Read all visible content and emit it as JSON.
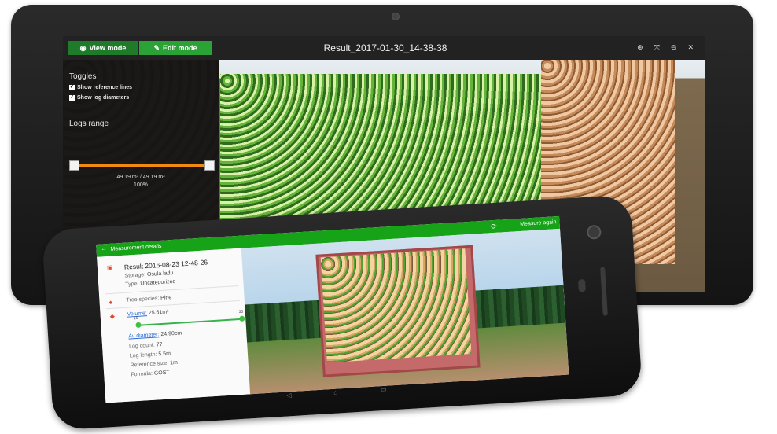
{
  "tablet": {
    "tabs": {
      "view": "View mode",
      "edit": "Edit mode"
    },
    "title": "Result_2017-01-30_14-38-38",
    "toolbar_icons": [
      "zoom-in-icon",
      "fit-icon",
      "zoom-out-icon",
      "close-icon"
    ],
    "toggles": {
      "heading": "Toggles",
      "items": [
        {
          "label": "Show reference lines",
          "checked": true
        },
        {
          "label": "Show log diameters",
          "checked": true
        }
      ]
    },
    "logs_range": {
      "heading": "Logs range",
      "value": "49.19 m³ / 49.19 m³",
      "percent": "100%",
      "fraction": 1.0
    },
    "accent_colors": {
      "green": "#2aa236",
      "orange": "#f08a15"
    }
  },
  "phone": {
    "header": {
      "back": "←",
      "label": "Measurement details",
      "action": "Measure again"
    },
    "result": {
      "title": "Result 2016-08-23 12-48-26",
      "storage_label": "Storage:",
      "storage_value": "Osula ladu",
      "type_label": "Type:",
      "type_value": "Uncategorized"
    },
    "species": {
      "label": "Tree species:",
      "value": "Pine"
    },
    "volume": {
      "label": "Volume:",
      "value": "25.61m³",
      "min": "16",
      "max": "30"
    },
    "stats": [
      {
        "label": "Av diameter:",
        "value": "24.90cm"
      },
      {
        "label": "Log count:",
        "value": "77"
      },
      {
        "label": "Log length:",
        "value": "5.5m"
      },
      {
        "label": "Reference size:",
        "value": "1m"
      },
      {
        "label": "Formula:",
        "value": "GOST"
      }
    ],
    "nav": {
      "back": "◁",
      "home": "⌂",
      "recent": "▭"
    }
  }
}
